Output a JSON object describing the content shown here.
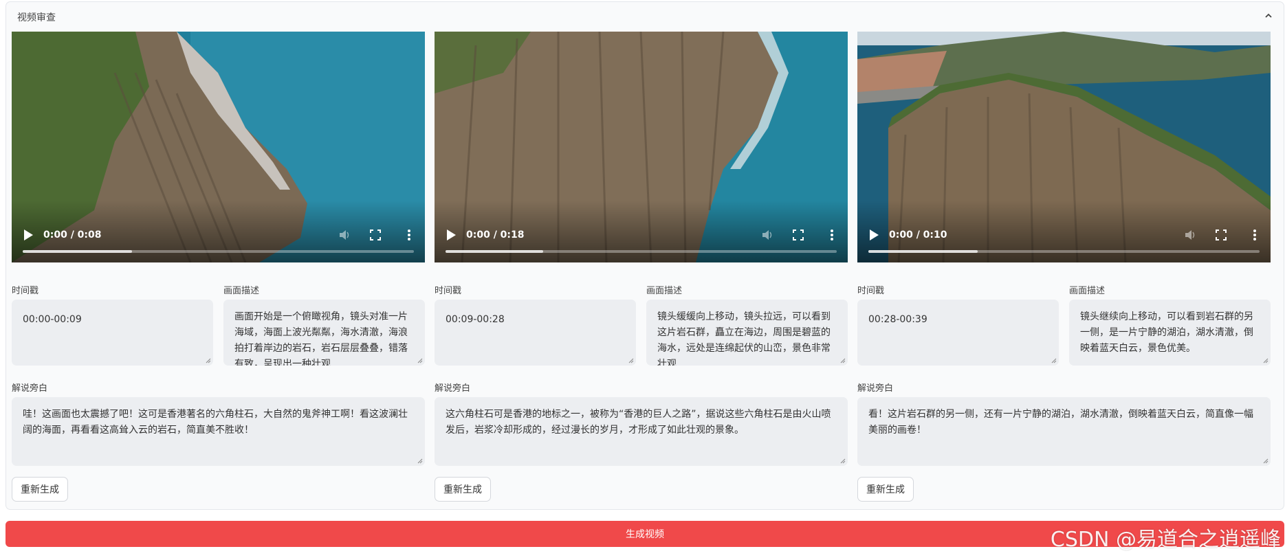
{
  "panel": {
    "title": "视频审查",
    "collapse_icon": "chevron-up-icon"
  },
  "labels": {
    "timestamp": "时间戳",
    "description": "画面描述",
    "narration": "解说旁白",
    "regenerate": "重新生成"
  },
  "clips": [
    {
      "time_display": "0:00 / 0:08",
      "timestamp": "00:00-00:09",
      "description": "画面开始是一个俯瞰视角，镜头对准一片海域，海面上波光粼粼，海水清澈，海浪拍打着岸边的岩石，岩石层层叠叠，错落有致，呈现出一种壮观",
      "narration": "哇！这画面也太震撼了吧！这可是香港著名的六角柱石，大自然的鬼斧神工啊！看这波澜壮阔的海面，再看看这高耸入云的岩石，简直美不胜收！"
    },
    {
      "time_display": "0:00 / 0:18",
      "timestamp": "00:09-00:28",
      "description": "镜头缓缓向上移动，镜头拉远，可以看到这片岩石群，矗立在海边，周围是碧蓝的海水，远处是连绵起伏的山峦，景色非常壮观",
      "narration": "这六角柱石可是香港的地标之一，被称为“香港的巨人之路”，据说这些六角柱石是由火山喷发后，岩浆冷却形成的，经过漫长的岁月，才形成了如此壮观的景象。"
    },
    {
      "time_display": "0:00 / 0:10",
      "timestamp": "00:28-00:39",
      "description": "镜头继续向上移动，可以看到岩石群的另一侧，是一片宁静的湖泊，湖水清澈，倒映着蓝天白云，景色优美。",
      "narration": "看！这片岩石群的另一侧，还有一片宁静的湖泊，湖水清澈，倒映着蓝天白云，简直像一幅美丽的画卷！"
    }
  ],
  "generate_button": "生成视频",
  "watermark": "CSDN @易道合之逍遥峰",
  "colors": {
    "accent": "#f0494a",
    "panel_bg": "#f9fafb",
    "field_bg": "#eceef1"
  }
}
